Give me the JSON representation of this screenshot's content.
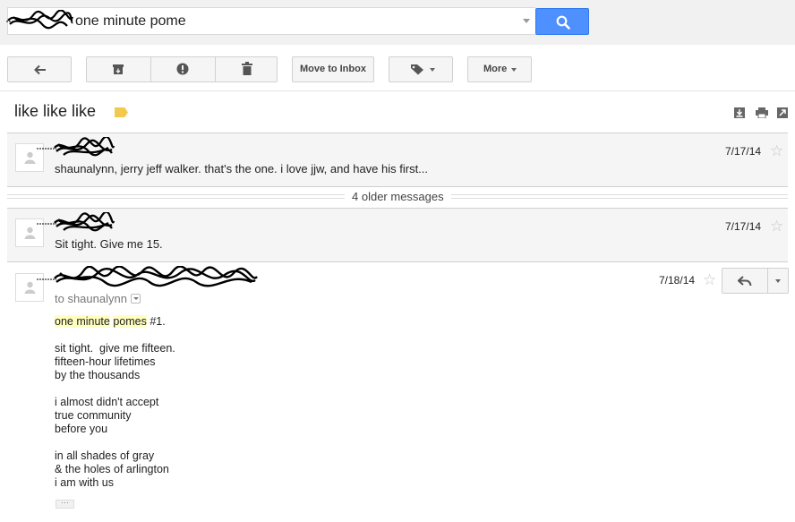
{
  "search": {
    "query": "one minute pome"
  },
  "toolbar": {
    "move_to_inbox": "Move to Inbox",
    "more": "More"
  },
  "thread": {
    "subject": "like like like",
    "older_messages": "4 older messages",
    "messages": [
      {
        "snippet": "shaunalynn, jerry jeff walker. that's the one. i love jjw, and have his first...",
        "date": "7/17/14"
      },
      {
        "snippet": "Sit tight. Give me 15.",
        "date": "7/17/14"
      }
    ],
    "expanded": {
      "date": "7/18/14",
      "to": "to shaunalynn",
      "body": {
        "l1_hl1": "one minute",
        "l1_space": " ",
        "l1_hl2": "pomes",
        "l1_rest": " #1.",
        "stanzas": [
          [
            "sit tight.  give me fifteen.",
            "fifteen-hour lifetimes",
            "by the thousands"
          ],
          [
            "i almost didn't accept",
            "true community",
            "before you"
          ],
          [
            "in all shades of gray",
            "& the holes of arlington",
            "i am with us"
          ]
        ]
      },
      "ellipsis": "···"
    }
  },
  "icons": {
    "back": "arrow-left-icon",
    "archive": "archive-icon",
    "spam": "report-spam-icon",
    "delete": "trash-icon",
    "labels": "label-icon",
    "search": "search-icon",
    "star": "star-icon",
    "reply": "reply-icon"
  },
  "colors": {
    "search_button": "#4d90fe",
    "label_tag": "#f2c94c",
    "highlight": "#ffffc0"
  }
}
